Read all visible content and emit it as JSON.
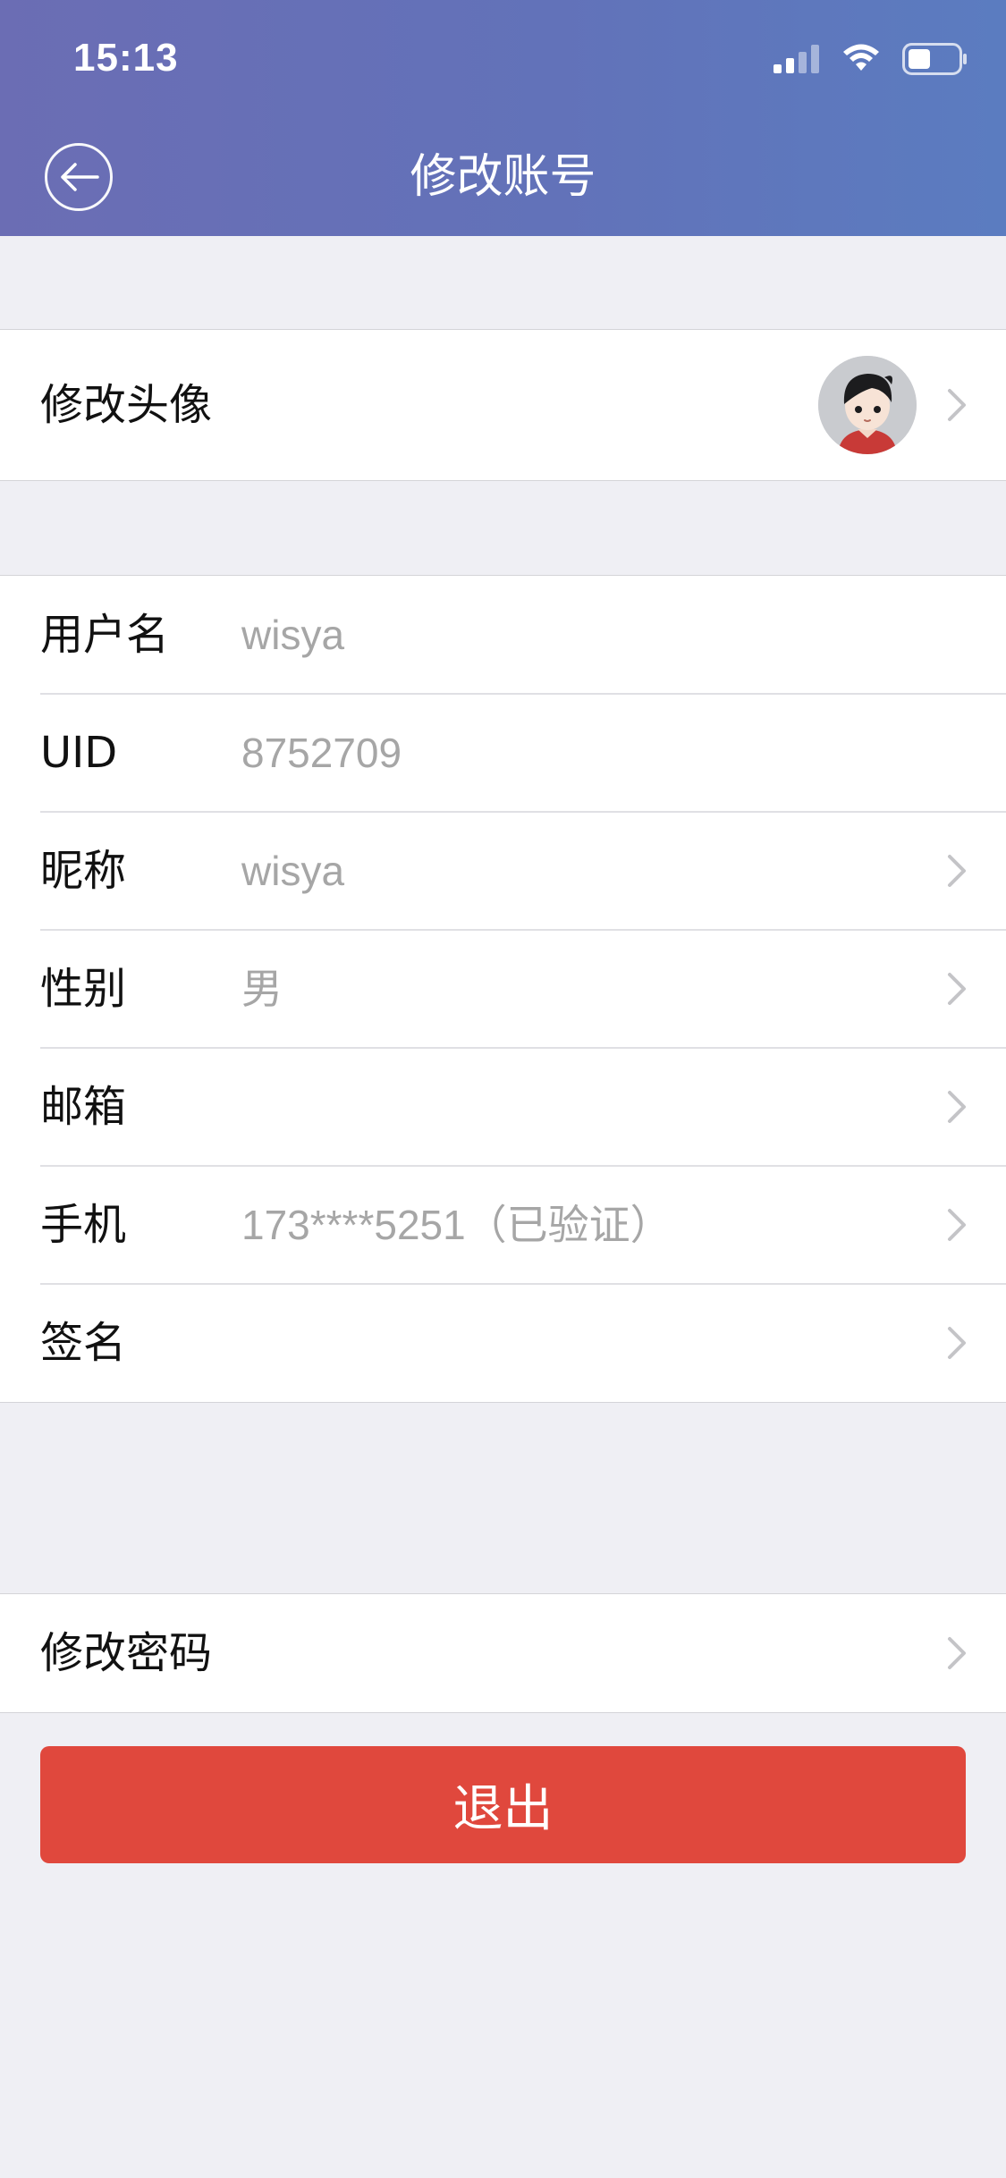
{
  "status_bar": {
    "time": "15:13",
    "icons": [
      "signal-icon",
      "wifi-icon",
      "battery-icon"
    ]
  },
  "header": {
    "title": "修改账号",
    "back_icon": "back-arrow-icon"
  },
  "avatar_row": {
    "label": "修改头像"
  },
  "profile_rows": [
    {
      "label": "用户名",
      "value": "wisya",
      "chevron": false
    },
    {
      "label": "UID",
      "value": "8752709",
      "chevron": false
    },
    {
      "label": "昵称",
      "value": "wisya",
      "chevron": true
    },
    {
      "label": "性别",
      "value": "男",
      "chevron": true
    },
    {
      "label": "邮箱",
      "value": "",
      "chevron": true
    },
    {
      "label": "手机",
      "value": "173****5251（已验证）",
      "chevron": true
    },
    {
      "label": "签名",
      "value": "",
      "chevron": true
    }
  ],
  "password_row": {
    "label": "修改密码"
  },
  "logout": {
    "label": "退出"
  },
  "colors": {
    "header_gradient_start": "#6b6db4",
    "header_gradient_end": "#5b7cc0",
    "logout_red": "#e0483d",
    "background": "#efeff4"
  }
}
